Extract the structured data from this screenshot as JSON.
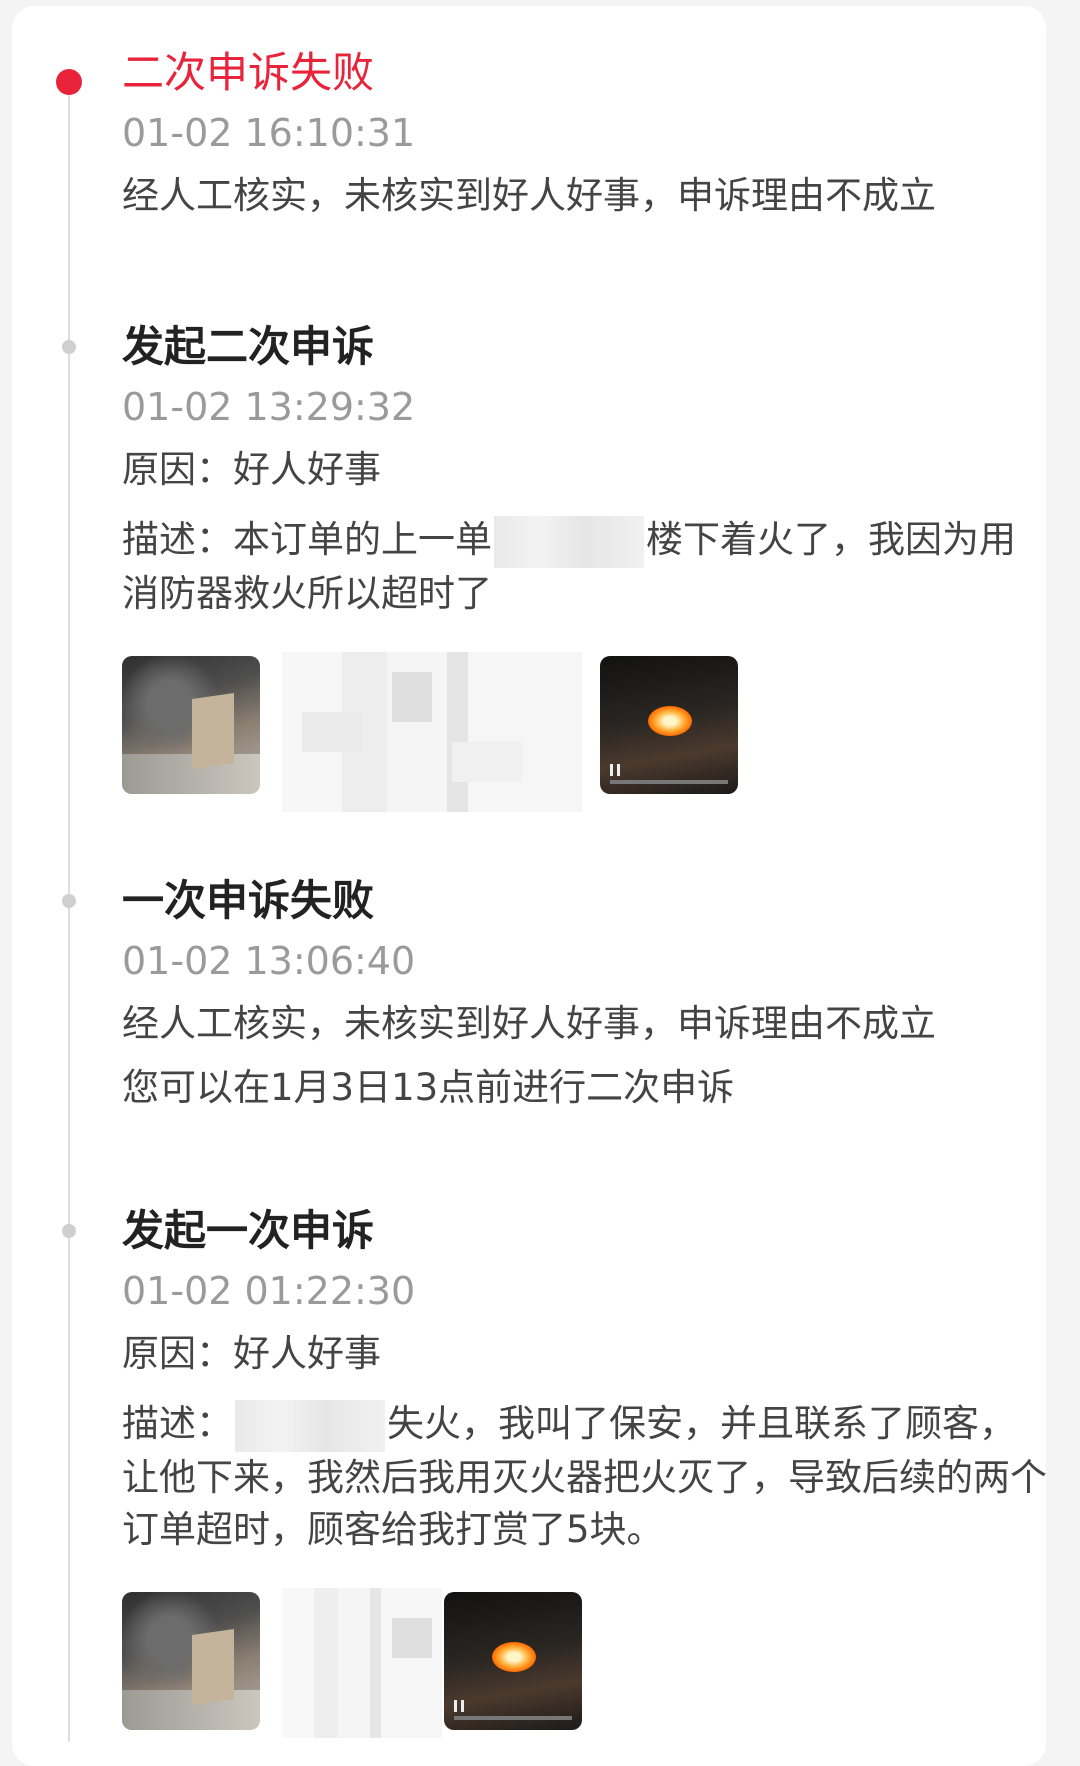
{
  "events": [
    {
      "title": "二次申诉失败",
      "time": "01-02 16:10:31",
      "lines": [
        "经人工核实，未核实到好人好事，申诉理由不成立"
      ]
    },
    {
      "title": "发起二次申诉",
      "time": "01-02 13:29:32",
      "reason": "原因：好人好事",
      "desc_part1": "描述：本订单的上一单",
      "desc_part2": "楼下着火了，我因为用消防器救火所以超时了"
    },
    {
      "title": "一次申诉失败",
      "time": "01-02 13:06:40",
      "lines": [
        "经人工核实，未核实到好人好事，申诉理由不成立",
        "您可以在1月3日13点前进行二次申诉"
      ]
    },
    {
      "title": "发起一次申诉",
      "time": "01-02 01:22:30",
      "reason": "原因：好人好事",
      "desc_part1": "描述：",
      "desc_part2": "失火，我叫了保安，并且联系了顾客，让他下来，我然后我用灭火器把火灭了，导致后续的两个订单超时，顾客给我打赏了5块。"
    }
  ],
  "colors": {
    "active": "#e8233a",
    "title": "#222222",
    "time": "#9a9a9a",
    "text": "#444444",
    "line": "#dedede"
  }
}
